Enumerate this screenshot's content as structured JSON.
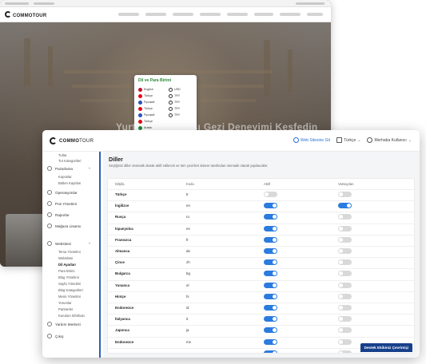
{
  "background_site": {
    "logo": "COMMOTOUR",
    "hero_title": "Yurtiçi ve Yurtdışı Gezi Deneyimi Keşfedin",
    "lang_popup": {
      "title": "Dil ve Para Birimi",
      "languages": [
        {
          "label": "English",
          "color": "#c8102e"
        },
        {
          "label": "Türkçe",
          "color": "#e30a17"
        },
        {
          "label": "Русский",
          "color": "#2a52be"
        },
        {
          "label": "Türkçe",
          "color": "#e30a17"
        },
        {
          "label": "Русский",
          "color": "#2a52be"
        },
        {
          "label": "Türkçe",
          "color": "#e30a17"
        },
        {
          "label": "Arabic",
          "color": "#1b8a3a"
        }
      ],
      "currencies": [
        "USD",
        "TRY",
        "TRY",
        "TRY",
        "TRY"
      ]
    }
  },
  "topbar": {
    "logo_commo": "COMMO",
    "logo_tour": "TOUR",
    "web_link": "Web Sitesine Git",
    "language": "Türkçe",
    "user": "Merhaba Kullanıcı"
  },
  "sidebar": {
    "top_subs": [
      "Turlar",
      "Tur Kategorileri"
    ],
    "items": [
      {
        "label": "Pazarlama",
        "chev": "^"
      },
      {
        "label": "Operasyonlar",
        "chev": ""
      },
      {
        "label": "Pos Yönetimi",
        "chev": ""
      },
      {
        "label": "Raporlar",
        "chev": ""
      },
      {
        "label": "Mağaza Lisansı",
        "chev": ""
      },
      {
        "label": "Websitesi",
        "chev": "^"
      },
      {
        "label": "Yardım Merkezi",
        "chev": ""
      },
      {
        "label": "Çıkış",
        "chev": ""
      }
    ],
    "pazarlama_subs": [
      "Kuponlar",
      "Bülten Kayıtları"
    ],
    "website_subs": [
      "Tema Yönetimi",
      "Websitesi",
      "Dil Ayarları",
      "Para Birimi",
      "Blog Yönetimi",
      "Sayfa Yönetimi",
      "Blog Kategorileri",
      "Menü Yönetimi",
      "Yorumlar",
      "Partnerler",
      "Kurulum Sihirbazı"
    ],
    "active_sub": "Dil Ayarları"
  },
  "main": {
    "title": "Diller",
    "description": "Seçtiğiniz diller otomatik olarak aktif edilecek ve tüm çevirileri sistem tarafından otomatik olarak yapılacaktır.",
    "columns": [
      "Dilşifa",
      "Kodu",
      "Aktif",
      "Varsayılan"
    ],
    "rows": [
      {
        "name": "Türkçe",
        "code": "tr",
        "active": false,
        "default": false
      },
      {
        "name": "İngilizce",
        "code": "en",
        "active": true,
        "default": true
      },
      {
        "name": "Rusça",
        "code": "ru",
        "active": true,
        "default": false
      },
      {
        "name": "İspanyolca",
        "code": "es",
        "active": true,
        "default": false
      },
      {
        "name": "Fransızca",
        "code": "fr",
        "active": true,
        "default": false
      },
      {
        "name": "Almanca",
        "code": "de",
        "active": true,
        "default": false
      },
      {
        "name": "Çince",
        "code": "zh",
        "active": true,
        "default": false
      },
      {
        "name": "Bulgarca",
        "code": "bg",
        "active": true,
        "default": false
      },
      {
        "name": "Yunanca",
        "code": "el",
        "active": true,
        "default": false
      },
      {
        "name": "Hintçe",
        "code": "hi",
        "active": true,
        "default": false
      },
      {
        "name": "Endonezce",
        "code": "id",
        "active": true,
        "default": false
      },
      {
        "name": "İtalyanca",
        "code": "it",
        "active": true,
        "default": false
      },
      {
        "name": "Japonca",
        "code": "ja",
        "active": true,
        "default": false
      },
      {
        "name": "Endonezce",
        "code": "ms",
        "active": true,
        "default": false
      },
      {
        "name": "",
        "code": "",
        "active": true,
        "default": false
      }
    ]
  },
  "support_button": "Destek Ekibiniz Çevrimiçi",
  "colors": {
    "accent": "#2b7be0",
    "support": "#17408b",
    "popup_title": "#2c8a3c"
  }
}
